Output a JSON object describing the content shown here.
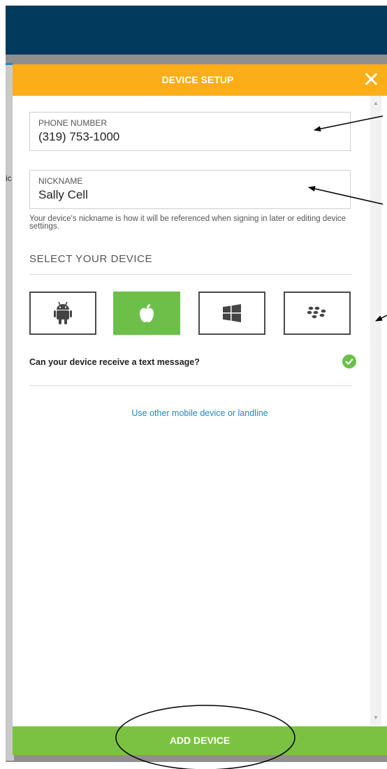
{
  "modal": {
    "title": "DEVICE SETUP",
    "close": "✕"
  },
  "background": {
    "partial_text": "ic"
  },
  "phone": {
    "label": "PHONE NUMBER",
    "value": "(319) 753-1000"
  },
  "nickname": {
    "label": "NICKNAME",
    "value": "Sally Cell",
    "help": "Your device's nickname is how it will be referenced when signing in later or editing device settings."
  },
  "device_select": {
    "title": "SELECT YOUR DEVICE",
    "options": [
      {
        "name": "android",
        "icon": "android-icon",
        "selected": false
      },
      {
        "name": "apple",
        "icon": "apple-icon",
        "selected": true
      },
      {
        "name": "windows",
        "icon": "windows-icon",
        "selected": false
      },
      {
        "name": "blackberry",
        "icon": "blackberry-icon",
        "selected": false
      }
    ]
  },
  "sms_question": "Can your device receive a text message?",
  "other_device_link": "Use other mobile device or landline",
  "add_button": "ADD DEVICE",
  "colors": {
    "topbar": "#003a5d",
    "header": "#fbae17",
    "accent_green": "#7cc242",
    "link": "#1e88c8"
  }
}
